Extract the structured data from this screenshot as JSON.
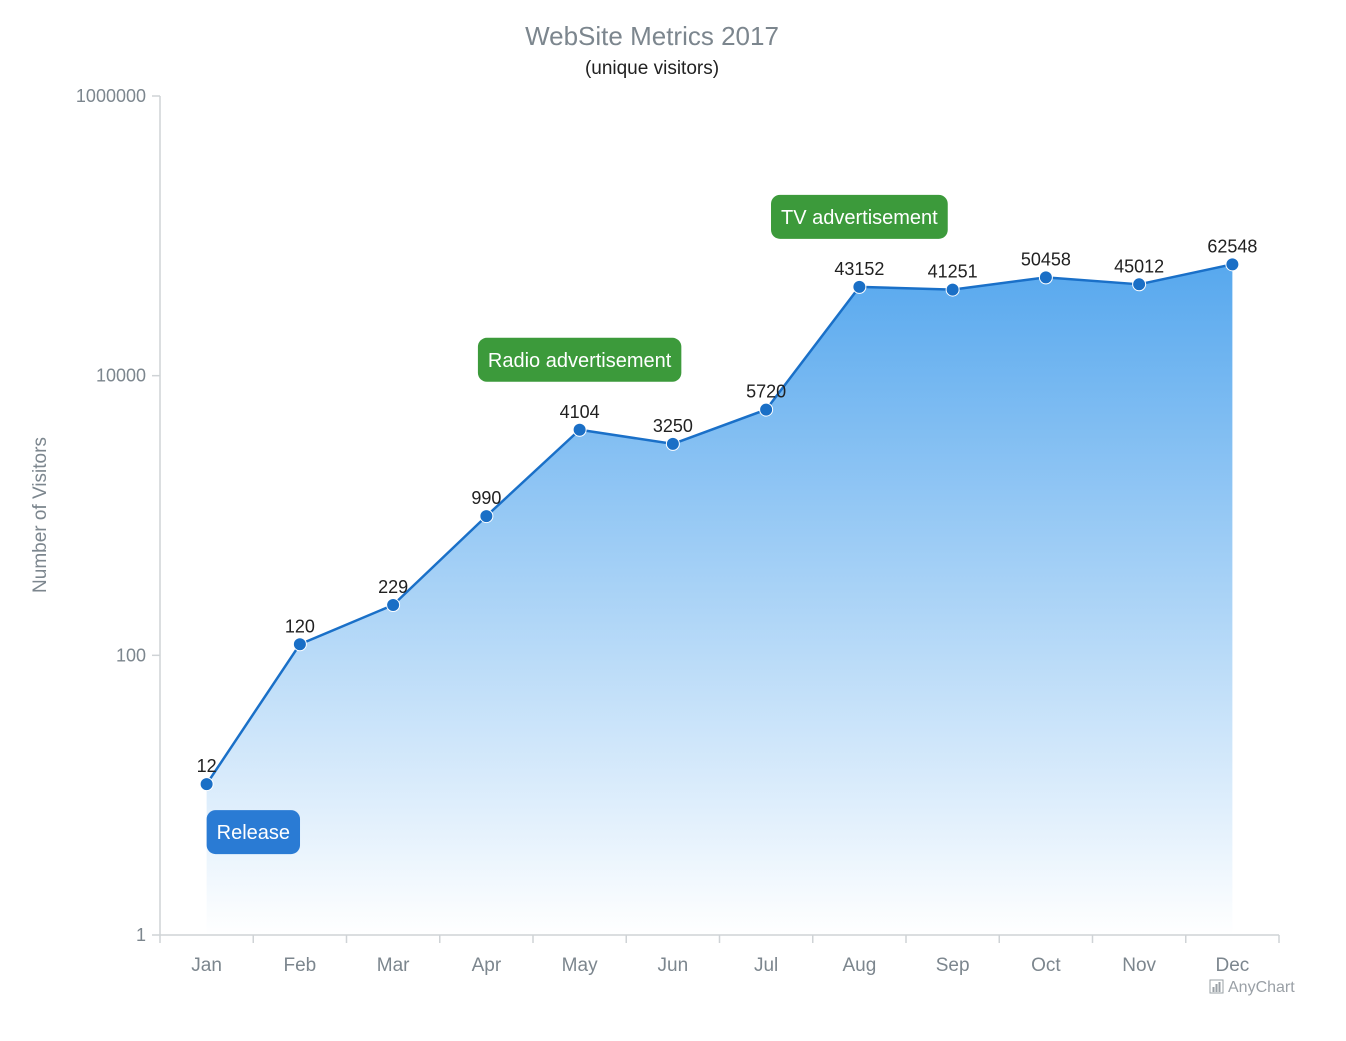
{
  "chart_data": {
    "type": "area",
    "title": "WebSite Metrics 2017",
    "subtitle": "(unique visitors)",
    "ylabel": "Number of Visitors",
    "xlabel": "",
    "y_scale": "log",
    "ylim": [
      1,
      1000000
    ],
    "y_ticks": [
      {
        "value": 1,
        "label": "1"
      },
      {
        "value": 100,
        "label": "100"
      },
      {
        "value": 10000,
        "label": "10000"
      },
      {
        "value": 1000000,
        "label": "1000000"
      }
    ],
    "categories": [
      "Jan",
      "Feb",
      "Mar",
      "Apr",
      "May",
      "Jun",
      "Jul",
      "Aug",
      "Sep",
      "Oct",
      "Nov",
      "Dec"
    ],
    "values": [
      12,
      120,
      229,
      990,
      4104,
      3250,
      5720,
      43152,
      41251,
      50458,
      45012,
      62548
    ],
    "data_labels": [
      "12",
      "120",
      "229",
      "990",
      "4104",
      "3250",
      "5720",
      "43152",
      "41251",
      "50458",
      "45012",
      "62548"
    ],
    "annotations": [
      {
        "text": "Release",
        "category": "Jan",
        "color": "#2a7bd4"
      },
      {
        "text": "Radio advertisement",
        "category": "May",
        "color": "#3c9a3b"
      },
      {
        "text": "TV advertisement",
        "category": "Aug",
        "color": "#3c9a3b"
      }
    ],
    "grid": false,
    "legend": "none",
    "colors": {
      "line": "#1a70c8",
      "marker": "#1a6fc6",
      "fill_top": "#57a8ee",
      "fill_bottom": "#ffffff"
    }
  },
  "credit": {
    "text": "AnyChart",
    "icon": "chart-logo-icon"
  }
}
